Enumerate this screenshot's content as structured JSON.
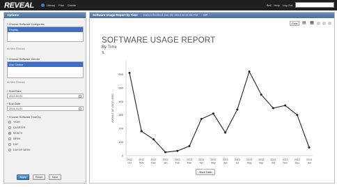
{
  "app": {
    "logo": "REVEAL",
    "nav": [
      "Library",
      "Plan",
      "Create"
    ],
    "top_right": [
      "Bell",
      "Help",
      "Log Out"
    ]
  },
  "sidebar": {
    "header": "Options",
    "category_label": "* Choose Software Categories",
    "category_selected": "Display",
    "category_note": "All New Choices",
    "vendor_label": "* Choose Software Vendor",
    "vendor_selected": "Any Choice",
    "vendor_note": "All New Choices",
    "start_label": "* Start Date",
    "start_value": "2012-01-01",
    "end_label": "* End Date",
    "end_value": "2014-01-01",
    "group_label": "* Choose Software Time by",
    "group_options": [
      {
        "label": "YEAR",
        "selected": false
      },
      {
        "label": "QUARTER",
        "selected": false
      },
      {
        "label": "MONTH",
        "selected": true
      },
      {
        "label": "WEEK",
        "selected": false
      },
      {
        "label": "DAY",
        "selected": false
      },
      {
        "label": "DAY OF WEEK",
        "selected": false
      }
    ],
    "buttons": {
      "apply": "Apply",
      "reset": "Reset",
      "save": "Save"
    }
  },
  "main": {
    "header_title": "Software Usage Report by Time",
    "header_sub": "Data refreshed Jan 15, 2014 at 11:06 PM",
    "header_ctrl": "CP",
    "toolbar_print": "Print"
  },
  "chart_data": {
    "type": "line",
    "title": "SOFTWARE USAGE REPORT",
    "subtitle": "By Time",
    "ylabel": "AMOUNT OF UNITS USED",
    "ylim": [
      0,
      700
    ],
    "yticks": [
      0,
      100,
      200,
      300,
      400,
      500,
      600
    ],
    "categories": [
      "2012 Oct",
      "2012 Nov",
      "2012 Dec",
      "2013 Jan",
      "2013 Feb",
      "2013 Mar",
      "2013 Apr",
      "2013 May",
      "2013 Jun",
      "2013 Jul",
      "2013 Aug",
      "2013 Sep",
      "2013 Oct",
      "2013 Nov",
      "2013 Dec",
      "2014 Jan"
    ],
    "values": [
      610,
      180,
      120,
      25,
      35,
      70,
      270,
      310,
      170,
      340,
      620,
      450,
      350,
      370,
      300,
      60
    ],
    "color": "#222222"
  },
  "more": {
    "label": "More Data"
  }
}
